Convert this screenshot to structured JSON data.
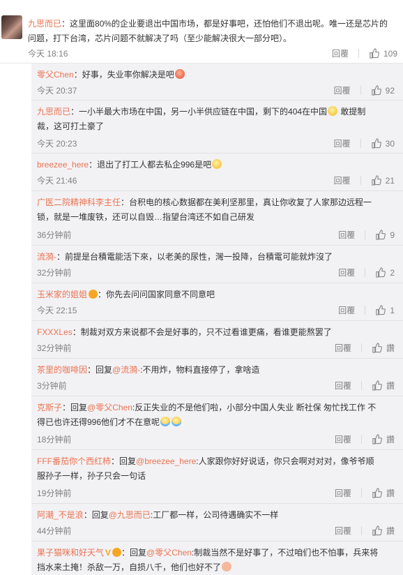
{
  "top_comment": {
    "name": "九思而已",
    "text": "：这里面80%的企业要退出中国市场，都是好事吧，还怕他们不退出呢。唯一还是芯片的问题，打下台湾，芯片问题不就解决了吗（至少能解决很大一部分吧）。",
    "time": "今天 18:16",
    "reply_label": "回覆",
    "likes": "109"
  },
  "replies": [
    {
      "name": "零父Chen",
      "text_a": "：好事，失业率你解决是吧",
      "emoji": "angry-emoji",
      "time": "今天 20:37",
      "reply_label": "回覆",
      "likes": "92"
    },
    {
      "name": "九思而已",
      "text_a": "：一小半最大市场在中国，另一小半供应链在中国，剩下的404在中国",
      "emoji": "laugh-emoji",
      "text_b": "敢提制裁，这可打土豪了",
      "time": "今天 20:23",
      "reply_label": "回覆",
      "likes": "30"
    },
    {
      "name": "breezee_here",
      "text_a": "：退出了打工人都去私企996是吧",
      "emoji": "thinking-emoji",
      "time": "今天 21:46",
      "reply_label": "回覆",
      "likes": "21"
    },
    {
      "name": "广医二院精神科李主任",
      "text_a": "：台积电的核心数据都在美利坚那里，真让你收复了人家那边远程一锁，就是一堆废铁，还可以自毁…指望台湾还不如自己研发",
      "time": "36分钟前",
      "reply_label": "回覆",
      "likes": "9"
    },
    {
      "name": "流漪-",
      "text_a": "：前提是台積電能活下來，以老美的尿性，灣一投降，台積電可能就炸沒了",
      "time": "32分钟前",
      "reply_label": "回覆",
      "likes": "2"
    },
    {
      "name": "玉米家的姐姐",
      "text_a": "：你先去问问国家同意不同意吧",
      "time": "今天 22:15",
      "reply_label": "回覆",
      "likes": "1"
    },
    {
      "name": "FXXXLes",
      "text_a": "：制裁对双方来说都不会是好事的，只不过看谁更痛，看谁更能熬罢了",
      "time": "32分钟前",
      "reply_label": "回覆",
      "likes": "讚"
    },
    {
      "name": "茶里的咖啡因",
      "text_a": "：回复",
      "mention": "@流漪-",
      "text_b": ":不用炸，物料直接停了，拿啥造",
      "time": "3分钟前",
      "reply_label": "回覆",
      "likes": "讚"
    },
    {
      "name": "克斯子",
      "text_a": "：回复",
      "mention": "@零父Chen",
      "text_b": ":反正失业的不是他们啦，小部分中国人失业 断社保 匆忙找工作 不得已也许还得996他们才不在意呢",
      "time": "18分钟前",
      "reply_label": "回覆",
      "likes": "讚"
    },
    {
      "name": "FFF番茄你个西红柿",
      "text_a": "：回复",
      "mention": "@breezee_here",
      "text_b": ":人家跟你好好说话，你只会啊对对对，像爷爷顺服孙子一样，孙子只会一句话",
      "time": "19分钟前",
      "reply_label": "回覆",
      "likes": "讚"
    },
    {
      "name": "阿潮_不是浪",
      "text_a": "：回复",
      "mention": "@九思而已",
      "text_b": ":工厂都一样，公司待遇确实不一样",
      "time": "44分钟前",
      "reply_label": "回覆",
      "likes": "讚"
    },
    {
      "name": "果子猫咪和好天气",
      "text_a": "：回复",
      "mention": "@零父Chen",
      "text_b": ":制裁当然不是好事了，不过咱们也不怕事，兵来将挡水来土掩！杀敌一万，自损八千，他们也好不了",
      "time": "",
      "reply_label": "",
      "likes": ""
    }
  ]
}
